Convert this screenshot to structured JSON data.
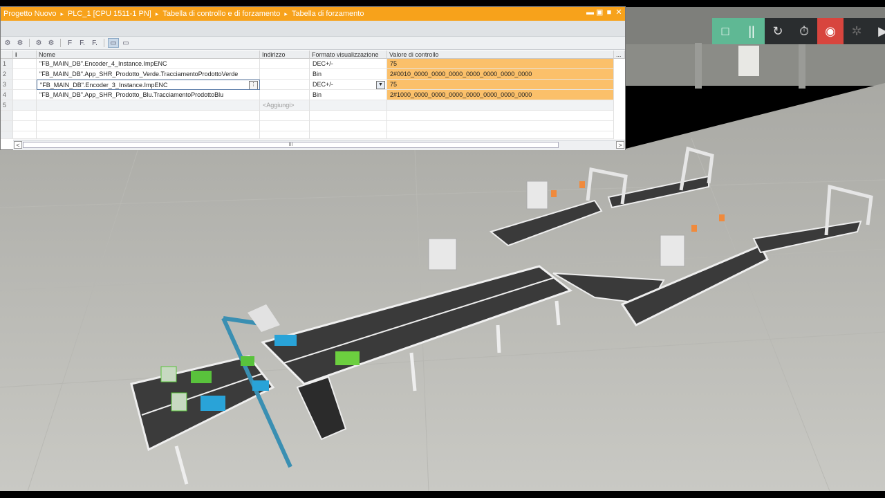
{
  "tia": {
    "breadcrumb": [
      "Progetto Nuovo",
      "PLC_1 [CPU 1511-1 PN]",
      "Tabella di controllo e di forzamento",
      "Tabella di forzamento"
    ],
    "window_controls": [
      "minimize",
      "restore",
      "maximize",
      "close"
    ],
    "toolbar_icons": [
      "monitor-icon",
      "modify-icon",
      "force-icon",
      "stop-force-icon",
      "f-icon",
      "f-dot-icon",
      "f-arrow-icon",
      "show-columns-icon",
      "expand-icon"
    ],
    "columns": {
      "info": "i",
      "name": "Nome",
      "address": "Indirizzo",
      "format": "Formato visualizzazione",
      "value": "Valore di controllo"
    },
    "rows": [
      {
        "num": "1",
        "name": "\"FB_MAIN_DB\".Encoder_4_Instance.ImpENC",
        "address": "",
        "format": "DEC+/-",
        "value": "75"
      },
      {
        "num": "2",
        "name": "\"FB_MAIN_DB\".App_SHR_Prodotto_Verde.TracciamentoProdottoVerde",
        "address": "",
        "format": "Bin",
        "value": "2#0010_0000_0000_0000_0000_0000_0000_0000"
      },
      {
        "num": "3",
        "name": "\"FB_MAIN_DB\".Encoder_3_Instance.ImpENC",
        "address": "",
        "format": "DEC+/-",
        "value": "75"
      },
      {
        "num": "4",
        "name": "\"FB_MAIN_DB\".App_SHR_Prodotto_Blu.TracciamentoProdottoBlu",
        "address": "",
        "format": "Bin",
        "value": "2#1000_0000_0000_0000_0000_0000_0000_0000"
      }
    ],
    "new_row": {
      "num": "5",
      "address": "<Aggiungi>"
    },
    "empty_row_nums": [
      "",
      "",
      ""
    ],
    "scrollbar_grip": "III",
    "scroll_left": "<",
    "scroll_right": ">",
    "colors": {
      "title_bar": "#f7a21b",
      "value_cell": "#fbc06a"
    }
  },
  "sim_toolbar": [
    {
      "name": "stop-icon",
      "glyph": "□",
      "style": "green"
    },
    {
      "name": "pause-icon",
      "glyph": "||",
      "style": "green"
    },
    {
      "name": "reset-icon",
      "glyph": "↻",
      "style": ""
    },
    {
      "name": "timer-icon",
      "glyph": "⏱",
      "style": ""
    },
    {
      "name": "record-icon",
      "glyph": "◉",
      "style": "red"
    },
    {
      "name": "fan-icon",
      "glyph": "✲",
      "style": "dim"
    },
    {
      "name": "camera-icon",
      "glyph": "▶",
      "style": ""
    }
  ]
}
